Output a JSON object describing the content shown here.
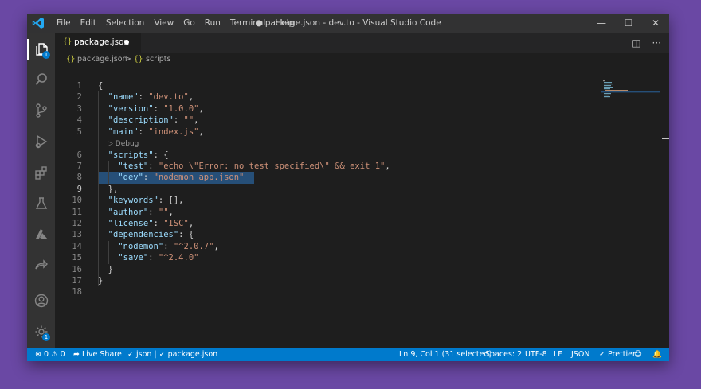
{
  "titlebar": {
    "menu": [
      "File",
      "Edit",
      "Selection",
      "View",
      "Go",
      "Run",
      "Terminal",
      "Help"
    ],
    "window_title": "● package.json - dev.to - Visual Studio Code"
  },
  "activity": {
    "explorer_badge": "1",
    "manage_badge": "1"
  },
  "tab": {
    "icon": "{}",
    "label": "package.json"
  },
  "breadcrumb": {
    "file": "package.json",
    "separator": ">",
    "icon": "{}",
    "section": "scripts"
  },
  "editor": {
    "line_numbers": [
      "1",
      "2",
      "3",
      "4",
      "5",
      "6",
      "7",
      "8",
      "9",
      "10",
      "11",
      "12",
      "13",
      "14",
      "15",
      "16",
      "17",
      "18"
    ],
    "codelens": "▷ Debug",
    "lines": [
      "{",
      "  \"name\": \"dev.to\",",
      "  \"version\": \"1.0.0\",",
      "  \"description\": \"\",",
      "  \"main\": \"index.js\",",
      "  \"scripts\": {",
      "    \"test\": \"echo \\\"Error: no test specified\\\" && exit 1\",",
      "    \"dev\": \"nodemon app.json\"",
      "  },",
      "  \"keywords\": [],",
      "  \"author\": \"\",",
      "  \"license\": \"ISC\",",
      "  \"dependencies\": {",
      "    \"nodemon\": \"^2.0.7\",",
      "    \"save\": \"^2.4.0\"",
      "  }",
      "}",
      ""
    ]
  },
  "status": {
    "problems": "⊗ 0 ⚠ 0",
    "live_share": "Live Share",
    "language_crumb": "✓ json | ✓ package.json",
    "cursor": "Ln 9, Col 1 (31 selected)",
    "spaces": "Spaces: 2",
    "encoding": "UTF-8",
    "eol": "LF",
    "language": "JSON",
    "prettier": "✓ Prettier"
  },
  "colors": {
    "accent": "#007acc",
    "editor_bg": "#1e1e1e",
    "key": "#9cdcfe",
    "string": "#ce9178",
    "selection": "#264f78"
  }
}
